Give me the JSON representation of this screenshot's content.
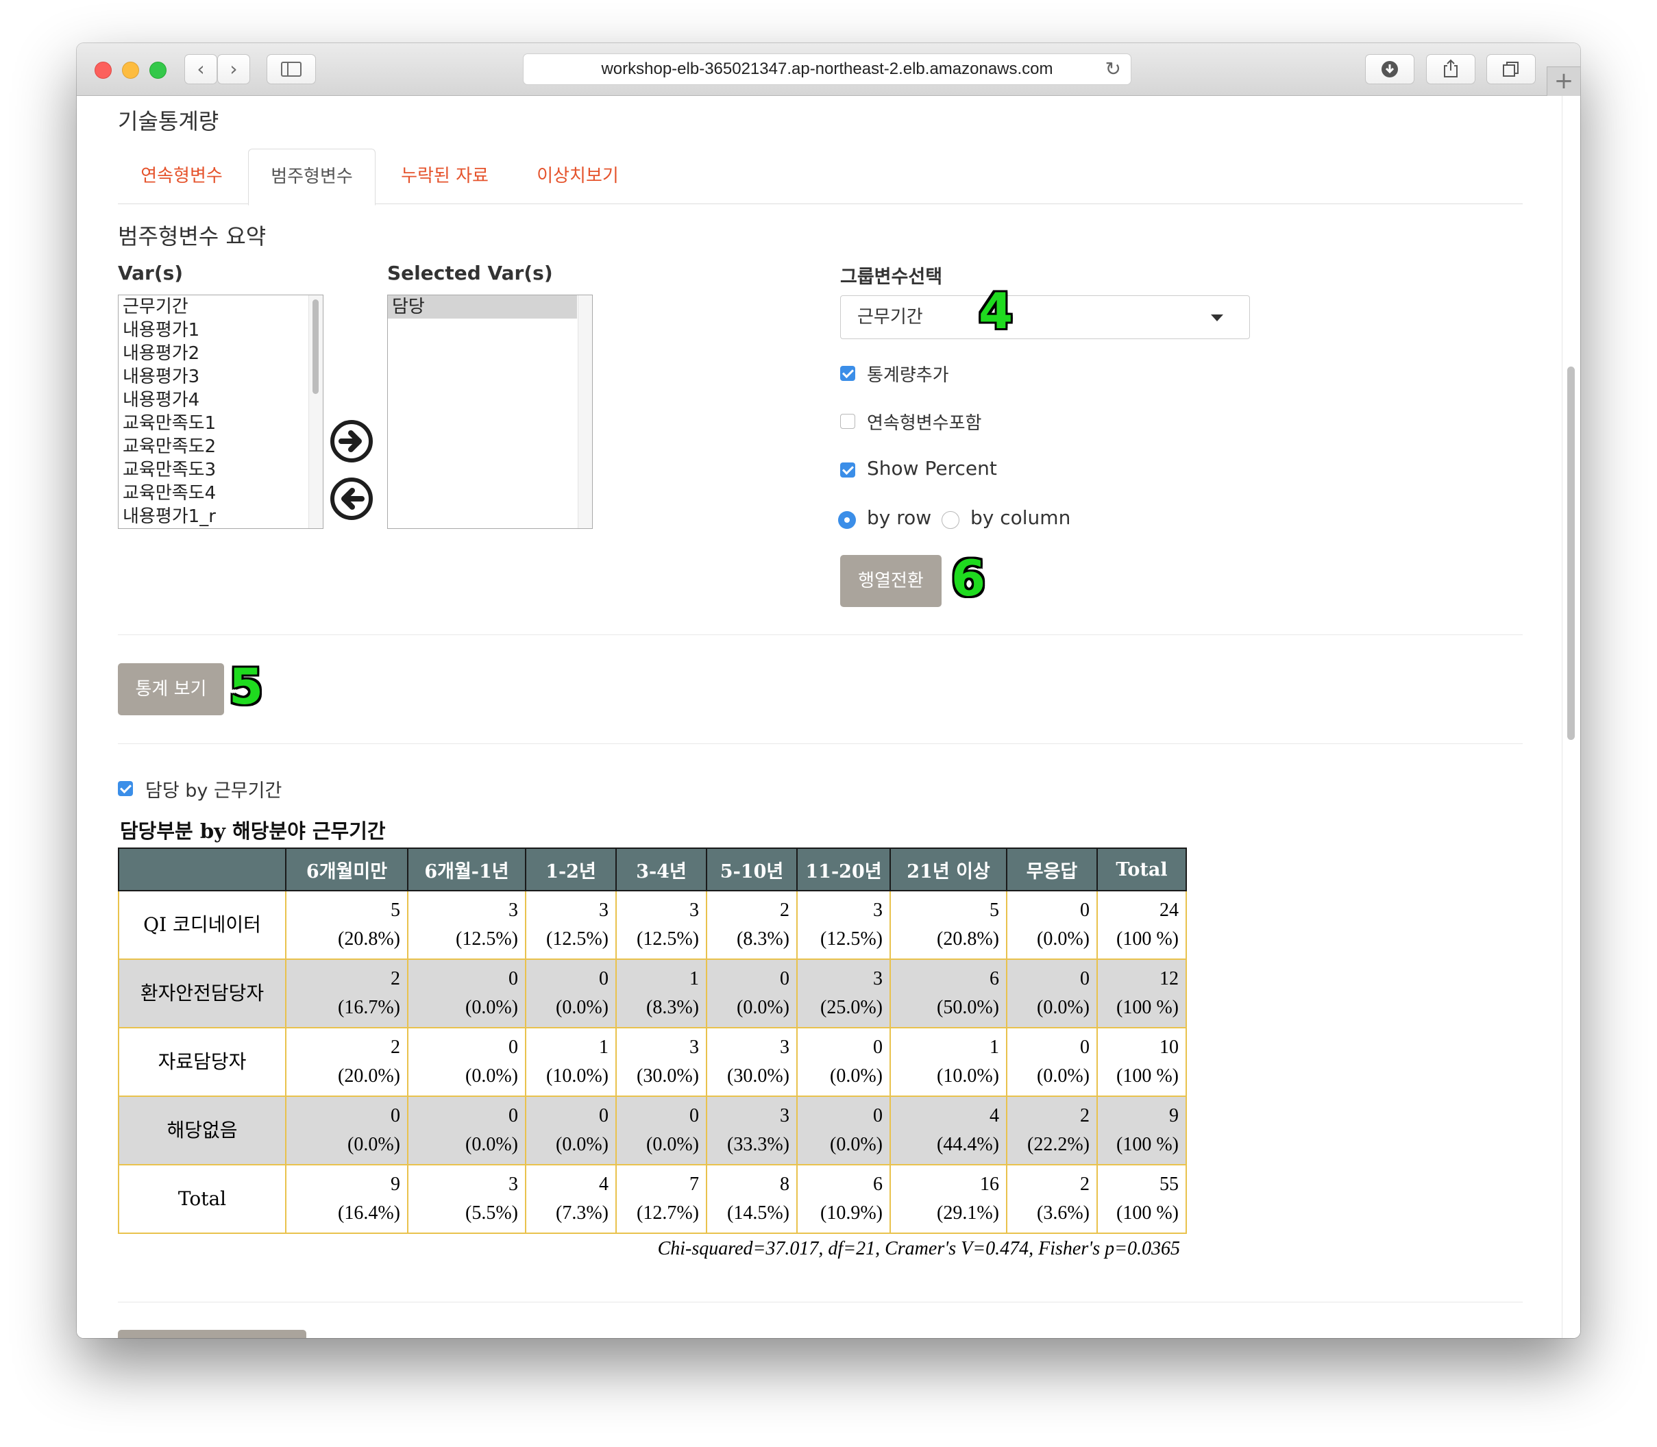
{
  "browser": {
    "url": "workshop-elb-365021347.ap-northeast-2.elb.amazonaws.com",
    "new_tab_label": "+"
  },
  "page": {
    "heading": "기술통계량",
    "tabs": [
      {
        "label": "연속형변수"
      },
      {
        "label": "범주형변수"
      },
      {
        "label": "누락된 자료"
      },
      {
        "label": "이상치보기"
      }
    ],
    "section_title": "범주형변수 요약",
    "vars_label": "Var(s)",
    "vars": [
      "근무기간",
      "내용평가1",
      "내용평가2",
      "내용평가3",
      "내용평가4",
      "교육만족도1",
      "교육만족도2",
      "교육만족도3",
      "교육만족도4",
      "내용평가1_r"
    ],
    "selected_label": "Selected Var(s)",
    "selected_vars": [
      "담당"
    ],
    "group_label": "그룹변수선택",
    "group_value": "근무기간",
    "options": {
      "add_stats": "통계량추가",
      "include_continuous": "연속형변수포함",
      "show_percent": "Show Percent",
      "by_row": "by row",
      "by_column": "by column"
    },
    "transpose_button": "행열전환",
    "view_button": "통계 보기",
    "markers": {
      "four": "4",
      "five": "5",
      "six": "6"
    },
    "result_checkbox": "담당 by 근무기간"
  },
  "table": {
    "title": "담당부분 by 해당분야 근무기간",
    "columns": [
      "6개월미만",
      "6개월-1년",
      "1-2년",
      "3-4년",
      "5-10년",
      "11-20년",
      "21년 이상",
      "무응답",
      "Total"
    ],
    "rows": [
      {
        "label": "QI 코디네이터",
        "counts": [
          "5",
          "3",
          "3",
          "3",
          "2",
          "3",
          "5",
          "0",
          "24"
        ],
        "pcts": [
          "(20.8%)",
          "(12.5%)",
          "(12.5%)",
          "(12.5%)",
          "(8.3%)",
          "(12.5%)",
          "(20.8%)",
          "(0.0%)",
          "(100 %)"
        ]
      },
      {
        "label": "환자안전담당자",
        "counts": [
          "2",
          "0",
          "0",
          "1",
          "0",
          "3",
          "6",
          "0",
          "12"
        ],
        "pcts": [
          "(16.7%)",
          "(0.0%)",
          "(0.0%)",
          "(8.3%)",
          "(0.0%)",
          "(25.0%)",
          "(50.0%)",
          "(0.0%)",
          "(100 %)"
        ]
      },
      {
        "label": "자료담당자",
        "counts": [
          "2",
          "0",
          "1",
          "3",
          "3",
          "0",
          "1",
          "0",
          "10"
        ],
        "pcts": [
          "(20.0%)",
          "(0.0%)",
          "(10.0%)",
          "(30.0%)",
          "(30.0%)",
          "(0.0%)",
          "(10.0%)",
          "(0.0%)",
          "(100 %)"
        ]
      },
      {
        "label": "해당없음",
        "counts": [
          "0",
          "0",
          "0",
          "0",
          "3",
          "0",
          "4",
          "2",
          "9"
        ],
        "pcts": [
          "(0.0%)",
          "(0.0%)",
          "(0.0%)",
          "(0.0%)",
          "(33.3%)",
          "(0.0%)",
          "(44.4%)",
          "(22.2%)",
          "(100 %)"
        ]
      },
      {
        "label": "Total",
        "counts": [
          "9",
          "3",
          "4",
          "7",
          "8",
          "6",
          "16",
          "2",
          "55"
        ],
        "pcts": [
          "(16.4%)",
          "(5.5%)",
          "(7.3%)",
          "(12.7%)",
          "(14.5%)",
          "(10.9%)",
          "(29.1%)",
          "(3.6%)",
          "(100 %)"
        ]
      }
    ],
    "stats": "Chi-squared=37.017, df=21, Cramer's V=0.474, Fisher's p=0.0365"
  }
}
